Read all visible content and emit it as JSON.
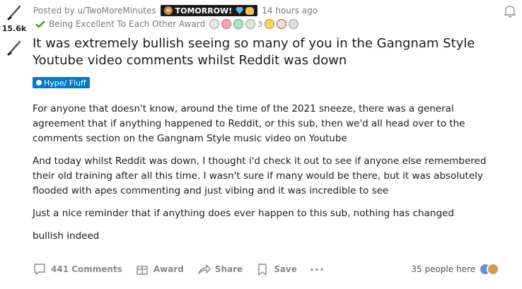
{
  "vote": {
    "score": "15.6k"
  },
  "meta": {
    "posted_by": "Posted by u/TwoMoreMinutes",
    "flair_text": "TOMORROW!",
    "time_ago": "14 hours ago"
  },
  "awards": {
    "primary_label": "Being Excellent To Each Other Award",
    "count": "3"
  },
  "post": {
    "title": "It was extremely bullish seeing so many of you in the Gangnam Style Youtube video comments whilst Reddit was down",
    "flair": "Hype/ Fluff",
    "paragraphs": [
      "For anyone that doesn't know, around the time of the 2021 sneeze, there was a general agreement that if anything happened to Reddit, or this sub, then we'd all head over to the comments section on the Gangnam Style music video on Youtube",
      "And today whilst Reddit was down, I thought i'd check it out to see if anyone else remembered their old training after all this time. I wasn't sure if many would be there, but it was absolutely flooded with apes commenting and just vibing and it was incredible to see",
      "Just a nice reminder that if anything does ever happen to this sub, nothing has changed",
      "bullish indeed"
    ]
  },
  "footer": {
    "comments": "441 Comments",
    "award": "Award",
    "share": "Share",
    "save": "Save",
    "more": "···",
    "viewers": "35 people here"
  },
  "colors": {
    "flair_bg": "#0079d3",
    "meta_text": "#787c7e",
    "footer_text": "#878a8c"
  }
}
